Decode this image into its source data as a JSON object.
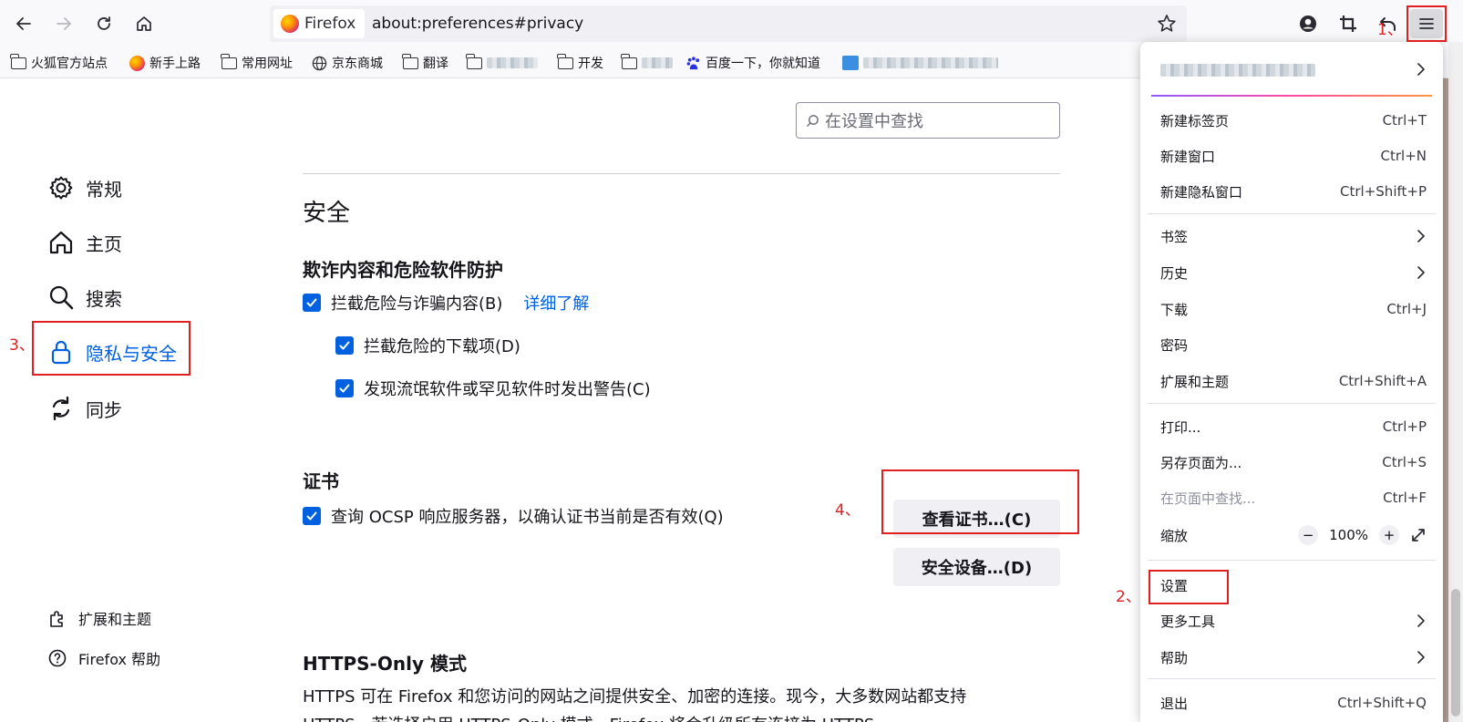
{
  "urlbar": {
    "identity": "Firefox",
    "url": "about:preferences#privacy"
  },
  "bookmarks": [
    {
      "label": "火狐官方站点",
      "icon": "folder-icon"
    },
    {
      "label": "新手上路",
      "icon": "firefox-icon"
    },
    {
      "label": "常用网址",
      "icon": "folder-icon"
    },
    {
      "label": "京东商城",
      "icon": "globe-icon"
    },
    {
      "label": "翻译",
      "icon": "folder-icon"
    },
    {
      "label": "开发",
      "icon": "folder-icon"
    },
    {
      "label": "百度一下，你就知道",
      "icon": "baidu-icon"
    }
  ],
  "search": {
    "placeholder": "在设置中查找"
  },
  "sidebar": {
    "items": [
      {
        "label": "常规",
        "icon": "gear-icon"
      },
      {
        "label": "主页",
        "icon": "home-icon"
      },
      {
        "label": "搜索",
        "icon": "search-icon"
      },
      {
        "label": "隐私与安全",
        "icon": "lock-icon",
        "selected": true
      },
      {
        "label": "同步",
        "icon": "sync-icon"
      }
    ],
    "footer": [
      {
        "label": "扩展和主题",
        "icon": "puzzle-icon"
      },
      {
        "label": "Firefox 帮助",
        "icon": "help-icon"
      }
    ]
  },
  "security": {
    "heading": "安全",
    "deceptive_heading": "欺诈内容和危险软件防护",
    "block_dangerous": "拦截危险与诈骗内容(B)",
    "learn_more": "详细了解",
    "block_downloads": "拦截危险的下载项(D)",
    "warn_unwanted": "发现流氓软件或罕见软件时发出警告(C)",
    "cert_heading": "证书",
    "ocsp": "查询 OCSP 响应服务器，以确认证书当前是否有效(Q)",
    "view_certs": "查看证书…(C)",
    "security_devices": "安全设备…(D)",
    "https_heading": "HTTPS-Only 模式",
    "https_desc_1": "HTTPS 可在 Firefox 和您访问的网站之间提供安全、加密的连接。现今，大多数网站都支持",
    "https_desc_2": "HTTPS，若选择启用 HTTPS-Only 模式，Firefox 将会升级所有连接为 HTTPS。"
  },
  "annotations": {
    "step1": "1、",
    "step2": "2、",
    "step3": "3、",
    "step4": "4、"
  },
  "menu": {
    "new_tab": "新建标签页",
    "new_tab_sc": "Ctrl+T",
    "new_window": "新建窗口",
    "new_window_sc": "Ctrl+N",
    "new_private": "新建隐私窗口",
    "new_private_sc": "Ctrl+Shift+P",
    "bookmarks": "书签",
    "history": "历史",
    "downloads": "下载",
    "downloads_sc": "Ctrl+J",
    "passwords": "密码",
    "addons": "扩展和主题",
    "addons_sc": "Ctrl+Shift+A",
    "print": "打印...",
    "print_sc": "Ctrl+P",
    "save_as": "另存页面为...",
    "save_as_sc": "Ctrl+S",
    "find": "在页面中查找...",
    "find_sc": "Ctrl+F",
    "zoom": "缩放",
    "zoom_minus": "−",
    "zoom_value": "100%",
    "zoom_plus": "+",
    "settings": "设置",
    "more_tools": "更多工具",
    "help": "帮助",
    "quit": "退出",
    "quit_sc": "Ctrl+Shift+Q"
  },
  "colors": {
    "accent": "#0061e0",
    "annotation": "#e02020"
  }
}
